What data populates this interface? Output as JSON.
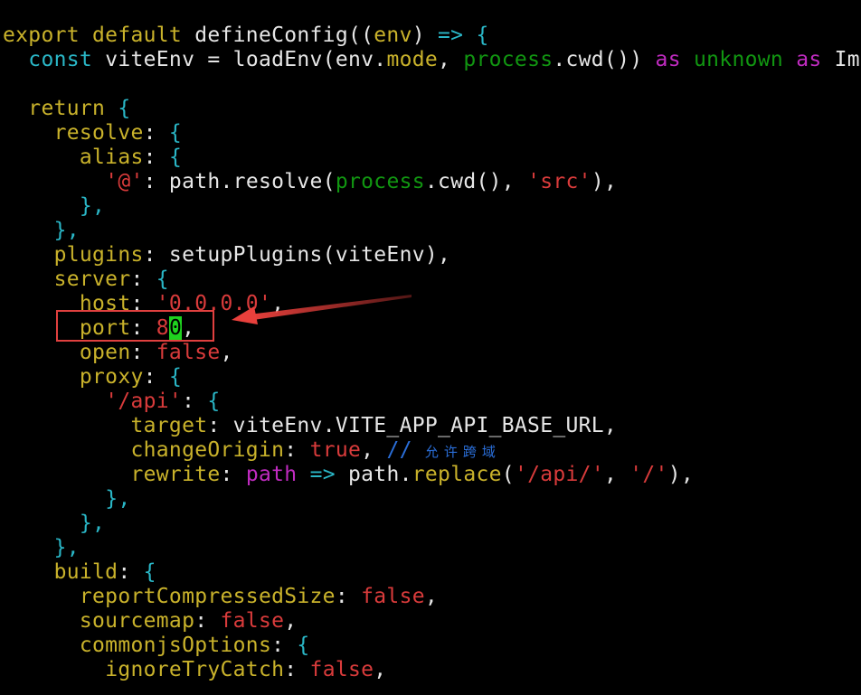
{
  "editor": {
    "palette": {
      "plain": "#e6e6e6",
      "keyword": "#c9b22b",
      "property": "#c9b22b",
      "bracket": "#2ab7c7",
      "string": "#d93b3b",
      "builtin": "#119611",
      "typekw": "#c02bc0",
      "comment": "#2a6ed8",
      "cursor_bg": "#1fd31f"
    },
    "lines": [
      [
        [
          "export default",
          "keyword"
        ],
        [
          " defineConfig((",
          "plain"
        ],
        [
          "env",
          "keyword"
        ],
        [
          ") ",
          "plain"
        ],
        [
          "=>",
          "bracket"
        ],
        [
          " ",
          "plain"
        ],
        [
          "{",
          "bracket"
        ]
      ],
      [
        [
          "  ",
          "plain"
        ],
        [
          "const",
          "bracket"
        ],
        [
          " viteEnv = loadEnv(env.",
          "plain"
        ],
        [
          "mode",
          "keyword"
        ],
        [
          ", ",
          "plain"
        ],
        [
          "process",
          "builtin"
        ],
        [
          ".cwd()) ",
          "plain"
        ],
        [
          "as",
          "typekw"
        ],
        [
          " ",
          "plain"
        ],
        [
          "unknown",
          "builtin"
        ],
        [
          " ",
          "plain"
        ],
        [
          "as",
          "typekw"
        ],
        [
          " Imp",
          "plain"
        ]
      ],
      [
        [
          "",
          "plain"
        ]
      ],
      [
        [
          "  ",
          "plain"
        ],
        [
          "return",
          "keyword"
        ],
        [
          " ",
          "plain"
        ],
        [
          "{",
          "bracket"
        ]
      ],
      [
        [
          "    ",
          "plain"
        ],
        [
          "resolve",
          "property"
        ],
        [
          ": ",
          "plain"
        ],
        [
          "{",
          "bracket"
        ]
      ],
      [
        [
          "      ",
          "plain"
        ],
        [
          "alias",
          "property"
        ],
        [
          ": ",
          "plain"
        ],
        [
          "{",
          "bracket"
        ]
      ],
      [
        [
          "        ",
          "plain"
        ],
        [
          "'@'",
          "string"
        ],
        [
          ": path.resolve(",
          "plain"
        ],
        [
          "process",
          "builtin"
        ],
        [
          ".cwd(), ",
          "plain"
        ],
        [
          "'src'",
          "string"
        ],
        [
          "),",
          "plain"
        ]
      ],
      [
        [
          "      ",
          "plain"
        ],
        [
          "},",
          "bracket"
        ]
      ],
      [
        [
          "    ",
          "plain"
        ],
        [
          "},",
          "bracket"
        ]
      ],
      [
        [
          "    ",
          "plain"
        ],
        [
          "plugins",
          "property"
        ],
        [
          ": setupPlugins(viteEnv),",
          "plain"
        ]
      ],
      [
        [
          "    ",
          "plain"
        ],
        [
          "server",
          "property"
        ],
        [
          ": ",
          "plain"
        ],
        [
          "{",
          "bracket"
        ]
      ],
      [
        [
          "      ",
          "plain"
        ],
        [
          "host",
          "property"
        ],
        [
          ": ",
          "plain"
        ],
        [
          "'0.0.0.0'",
          "string"
        ],
        [
          ",",
          "plain"
        ]
      ],
      [
        [
          "      ",
          "plain"
        ],
        [
          "port",
          "property"
        ],
        [
          ": ",
          "plain"
        ],
        [
          "8",
          "string"
        ],
        [
          "0",
          "cursor"
        ],
        [
          ",",
          "plain"
        ]
      ],
      [
        [
          "      ",
          "plain"
        ],
        [
          "open",
          "property"
        ],
        [
          ": ",
          "plain"
        ],
        [
          "false",
          "string"
        ],
        [
          ",",
          "plain"
        ]
      ],
      [
        [
          "      ",
          "plain"
        ],
        [
          "proxy",
          "property"
        ],
        [
          ": ",
          "plain"
        ],
        [
          "{",
          "bracket"
        ]
      ],
      [
        [
          "        ",
          "plain"
        ],
        [
          "'/api'",
          "string"
        ],
        [
          ": ",
          "plain"
        ],
        [
          "{",
          "bracket"
        ]
      ],
      [
        [
          "          ",
          "plain"
        ],
        [
          "target",
          "property"
        ],
        [
          ": viteEnv.VITE_APP_API_BASE_URL,",
          "plain"
        ]
      ],
      [
        [
          "          ",
          "plain"
        ],
        [
          "changeOrigin",
          "property"
        ],
        [
          ": ",
          "plain"
        ],
        [
          "true",
          "string"
        ],
        [
          ", ",
          "plain"
        ],
        [
          "// ",
          "comment"
        ],
        [
          "允许跨域",
          "comment-cjk"
        ]
      ],
      [
        [
          "          ",
          "plain"
        ],
        [
          "rewrite",
          "property"
        ],
        [
          ": ",
          "plain"
        ],
        [
          "path",
          "typekw"
        ],
        [
          " ",
          "plain"
        ],
        [
          "=>",
          "bracket"
        ],
        [
          " path.",
          "plain"
        ],
        [
          "replace",
          "property"
        ],
        [
          "(",
          "plain"
        ],
        [
          "'/api/'",
          "string"
        ],
        [
          ", ",
          "plain"
        ],
        [
          "'/'",
          "string"
        ],
        [
          "),",
          "plain"
        ]
      ],
      [
        [
          "        ",
          "plain"
        ],
        [
          "},",
          "bracket"
        ]
      ],
      [
        [
          "      ",
          "plain"
        ],
        [
          "},",
          "bracket"
        ]
      ],
      [
        [
          "    ",
          "plain"
        ],
        [
          "},",
          "bracket"
        ]
      ],
      [
        [
          "    ",
          "plain"
        ],
        [
          "build",
          "property"
        ],
        [
          ": ",
          "plain"
        ],
        [
          "{",
          "bracket"
        ]
      ],
      [
        [
          "      ",
          "plain"
        ],
        [
          "reportCompressedSize",
          "property"
        ],
        [
          ": ",
          "plain"
        ],
        [
          "false",
          "string"
        ],
        [
          ",",
          "plain"
        ]
      ],
      [
        [
          "      ",
          "plain"
        ],
        [
          "sourcemap",
          "property"
        ],
        [
          ": ",
          "plain"
        ],
        [
          "false",
          "string"
        ],
        [
          ",",
          "plain"
        ]
      ],
      [
        [
          "      ",
          "plain"
        ],
        [
          "commonjsOptions",
          "property"
        ],
        [
          ": ",
          "plain"
        ],
        [
          "{",
          "bracket"
        ]
      ],
      [
        [
          "        ",
          "plain"
        ],
        [
          "ignoreTryCatch",
          "property"
        ],
        [
          ": ",
          "plain"
        ],
        [
          "false",
          "string"
        ],
        [
          ",",
          "plain"
        ]
      ]
    ]
  },
  "annotation": {
    "box_color": "#e0403f",
    "arrow_color": "#e8403c"
  }
}
